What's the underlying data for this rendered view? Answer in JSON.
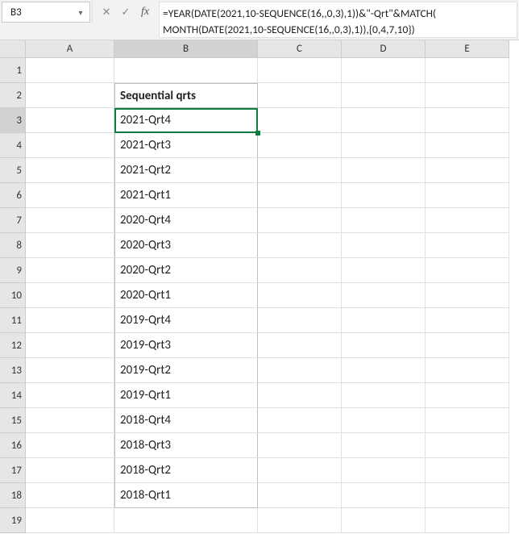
{
  "namebox": {
    "value": "B3"
  },
  "fx": {
    "cancel": "✕",
    "confirm": "✓",
    "label": "fx"
  },
  "formula": "=YEAR(DATE(2021,10-SEQUENCE(16,,0,3),1))&\"-Qrt\"&MATCH(\nMONTH(DATE(2021,10-SEQUENCE(16,,0,3),1)),{0,4,7,10})",
  "columns": [
    "A",
    "B",
    "C",
    "D",
    "E"
  ],
  "rows": [
    "1",
    "2",
    "3",
    "4",
    "5",
    "6",
    "7",
    "8",
    "9",
    "10",
    "11",
    "12",
    "13",
    "14",
    "15",
    "16",
    "17",
    "18",
    "19"
  ],
  "header_cell": "Sequential qrts",
  "values": [
    "2021-Qrt4",
    "2021-Qrt3",
    "2021-Qrt2",
    "2021-Qrt1",
    "2020-Qrt4",
    "2020-Qrt3",
    "2020-Qrt2",
    "2020-Qrt1",
    "2019-Qrt4",
    "2019-Qrt3",
    "2019-Qrt2",
    "2019-Qrt1",
    "2018-Qrt4",
    "2018-Qrt3",
    "2018-Qrt2",
    "2018-Qrt1"
  ],
  "active_cell": "B3",
  "chart_data": {
    "type": "table",
    "title": "Sequential qrts",
    "categories": [
      "2021-Qrt4",
      "2021-Qrt3",
      "2021-Qrt2",
      "2021-Qrt1",
      "2020-Qrt4",
      "2020-Qrt3",
      "2020-Qrt2",
      "2020-Qrt1",
      "2019-Qrt4",
      "2019-Qrt3",
      "2019-Qrt2",
      "2019-Qrt1",
      "2018-Qrt4",
      "2018-Qrt3",
      "2018-Qrt2",
      "2018-Qrt1"
    ]
  }
}
